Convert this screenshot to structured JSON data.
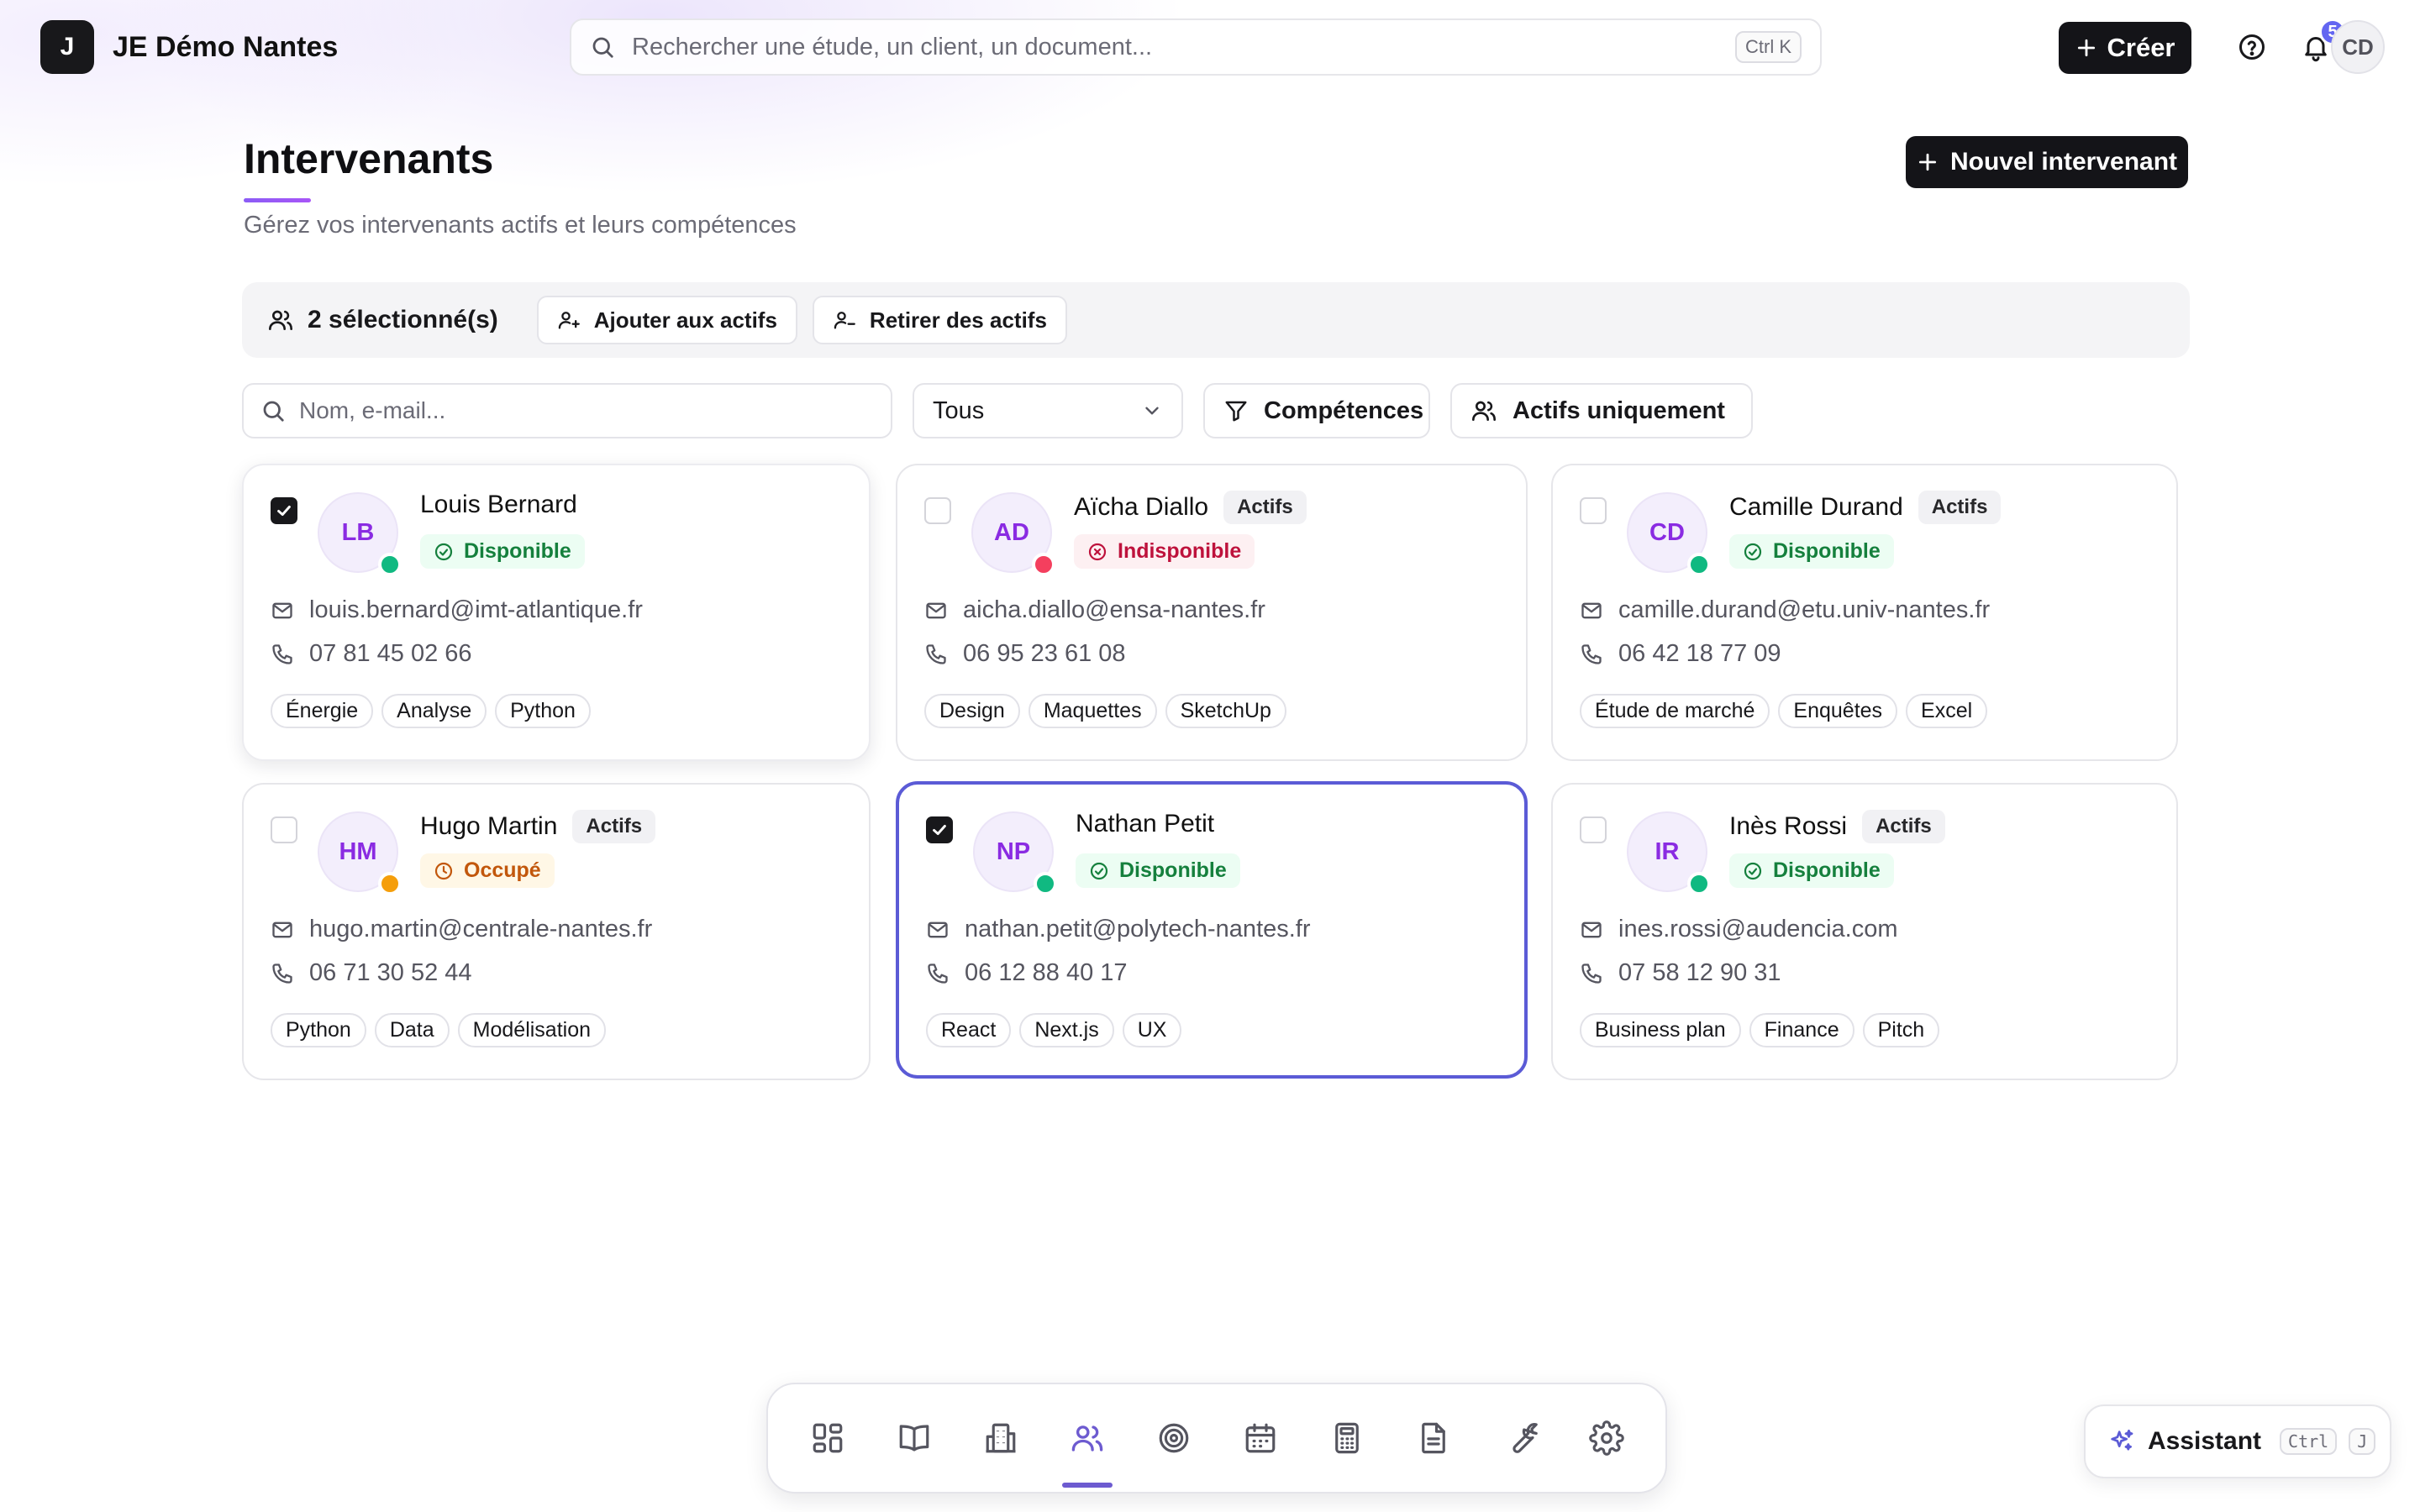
{
  "app": {
    "logo_letter": "J",
    "name": "JE Démo Nantes"
  },
  "search": {
    "placeholder": "Rechercher une étude, un client, un document...",
    "shortcut": "Ctrl K"
  },
  "header": {
    "create_label": "Créer",
    "notifications_count": "5",
    "user_initials": "CD"
  },
  "page": {
    "title": "Intervenants",
    "subtitle": "Gérez vos intervenants actifs et leurs compétences",
    "new_button": "Nouvel intervenant"
  },
  "selection": {
    "count_label": "2 sélectionné(s)",
    "add_label": "Ajouter aux actifs",
    "remove_label": "Retirer des actifs"
  },
  "filters": {
    "search_placeholder": "Nom, e-mail...",
    "status_value": "Tous",
    "skills_label": "Compétences",
    "active_only_label": "Actifs uniquement"
  },
  "colors": {
    "available": "#10b981",
    "unavailable": "#f43f5e",
    "busy": "#f59e0b",
    "accent": "#5b5bd6"
  },
  "cards": [
    {
      "initials": "LB",
      "name": "Louis Bernard",
      "actifs": "",
      "status": "Disponible",
      "status_type": "green",
      "email": "louis.bernard@imt-atlantique.fr",
      "phone": "07 81 45 02 66",
      "skills": [
        "Énergie",
        "Analyse",
        "Python"
      ],
      "checked": true
    },
    {
      "initials": "AD",
      "name": "Aïcha Diallo",
      "actifs": "Actifs",
      "status": "Indisponible",
      "status_type": "red",
      "email": "aicha.diallo@ensa-nantes.fr",
      "phone": "06 95 23 61 08",
      "skills": [
        "Design",
        "Maquettes",
        "SketchUp"
      ],
      "checked": false
    },
    {
      "initials": "CD",
      "name": "Camille Durand",
      "actifs": "Actifs",
      "status": "Disponible",
      "status_type": "green",
      "email": "camille.durand@etu.univ-nantes.fr",
      "phone": "06 42 18 77 09",
      "skills": [
        "Étude de marché",
        "Enquêtes",
        "Excel"
      ],
      "checked": false
    },
    {
      "initials": "HM",
      "name": "Hugo Martin",
      "actifs": "Actifs",
      "status": "Occupé",
      "status_type": "orange",
      "email": "hugo.martin@centrale-nantes.fr",
      "phone": "06 71 30 52 44",
      "skills": [
        "Python",
        "Data",
        "Modélisation"
      ],
      "checked": false
    },
    {
      "initials": "NP",
      "name": "Nathan Petit",
      "actifs": "",
      "status": "Disponible",
      "status_type": "green",
      "email": "nathan.petit@polytech-nantes.fr",
      "phone": "06 12 88 40 17",
      "skills": [
        "React",
        "Next.js",
        "UX"
      ],
      "checked": true
    },
    {
      "initials": "IR",
      "name": "Inès Rossi",
      "actifs": "Actifs",
      "status": "Disponible",
      "status_type": "green",
      "email": "ines.rossi@audencia.com",
      "phone": "07 58 12 90 31",
      "skills": [
        "Business plan",
        "Finance",
        "Pitch"
      ],
      "checked": false
    }
  ],
  "dock": {
    "items": [
      "dashboard-icon",
      "book-icon",
      "building-icon",
      "users-icon",
      "target-icon",
      "calendar-icon",
      "calculator-icon",
      "document-icon",
      "wrench-icon",
      "settings-icon"
    ],
    "active": "users-icon"
  },
  "assistant": {
    "label": "Assistant",
    "key1": "Ctrl",
    "key2": "J"
  }
}
